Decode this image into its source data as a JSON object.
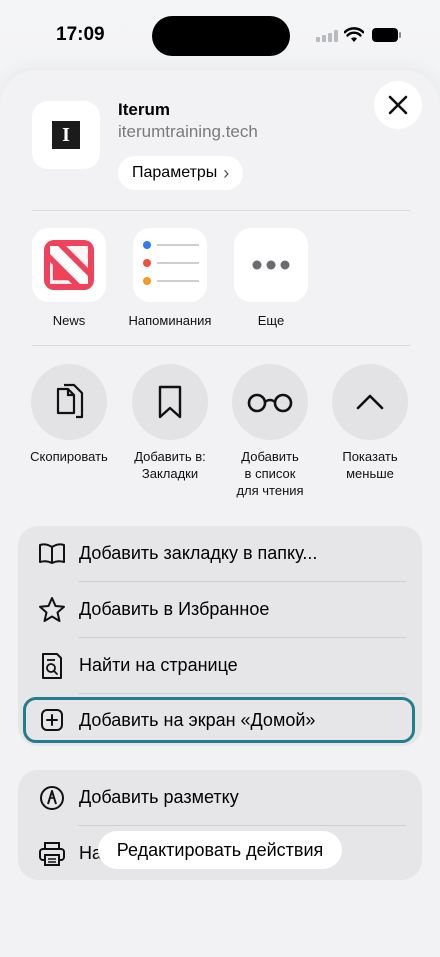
{
  "status_bar": {
    "time": "17:09"
  },
  "site": {
    "name": "Iterum",
    "url": "iterumtraining.tech",
    "logo_letter": "I",
    "params_label": "Параметры"
  },
  "apps": [
    {
      "label": "News",
      "icon": "news-icon"
    },
    {
      "label": "Напоминания",
      "icon": "reminders-icon"
    },
    {
      "label": "Еще",
      "icon": "more-icon"
    }
  ],
  "actions": [
    {
      "label": "Скопировать",
      "icon": "copy-icon"
    },
    {
      "label": "Добавить в:\nЗакладки",
      "icon": "bookmark-icon"
    },
    {
      "label": "Добавить\nв список\nдля чтения",
      "icon": "glasses-icon"
    },
    {
      "label": "Показать\nменьше",
      "icon": "chevron-up-icon"
    }
  ],
  "menu_group_1": [
    {
      "label": "Добавить закладку в папку...",
      "icon": "book-icon"
    },
    {
      "label": "Добавить в Избранное",
      "icon": "star-icon"
    },
    {
      "label": "Найти на странице",
      "icon": "find-in-page-icon"
    },
    {
      "label": "Добавить на экран «Домой»",
      "icon": "add-square-icon",
      "highlighted": true
    }
  ],
  "menu_group_2": [
    {
      "label": "Добавить разметку",
      "icon": "markup-icon"
    },
    {
      "label": "Напечатать",
      "icon": "printer-icon"
    }
  ],
  "edit_actions_label": "Редактировать действия",
  "colors": {
    "highlight": "#237d8c",
    "sheet_bg": "#f2f2f4",
    "news_red": "#f0425a"
  }
}
